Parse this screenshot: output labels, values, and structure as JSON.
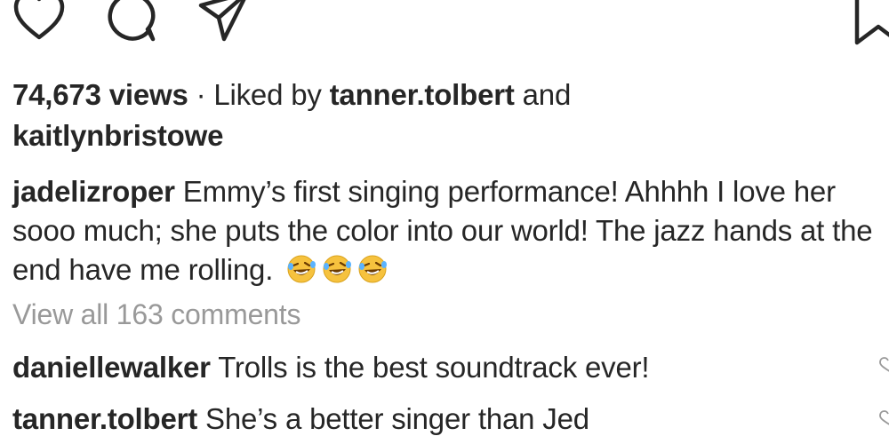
{
  "actions": {
    "like_icon": "heart-outline-icon",
    "comment_icon": "speech-bubble-icon",
    "share_icon": "paper-plane-icon",
    "save_icon": "bookmark-icon"
  },
  "likes": {
    "views": "74,673 views",
    "separator": " · Liked by ",
    "user1": "tanner.tolbert",
    "and": " and",
    "user2": "kaitlynbristowe"
  },
  "caption": {
    "author": "jadelizroper",
    "text": " Emmy’s first singing performance! Ahhhh I love her sooo much; she puts the color into our world! The jazz hands at the end have me rolling.",
    "emoji_count": 3,
    "emoji_name": "rolling-on-floor-laughing-emoji"
  },
  "view_all": "View all 163 comments",
  "comments": [
    {
      "user": "daniellewalker",
      "text": " Trolls is the best soundtrack ever!"
    },
    {
      "user": "tanner.tolbert",
      "text": " She’s a better singer than Jed"
    }
  ],
  "colors": {
    "text": "#262626",
    "muted": "#999999",
    "emoji_yellow": "#f6c23e"
  }
}
